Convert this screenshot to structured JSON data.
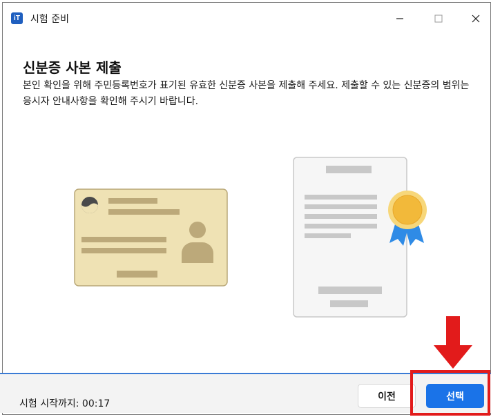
{
  "window": {
    "title": "시험 준비",
    "icon": "app-logo-icon",
    "icon_text": "iT",
    "controls": [
      "minimize-icon",
      "maximize-icon",
      "close-icon"
    ]
  },
  "main": {
    "heading": "신분증 사본 제출",
    "description": "본인 확인을 위해 주민등록번호가 표기된 유효한 신분증 사본을 제출해 주세요. 제출할 수 있는 신분증의 범위는 응시자 안내사항을 확인해 주시기 바랍니다."
  },
  "illustrations": {
    "id_card": "id-card-illustration",
    "certificate": "certificate-illustration",
    "colors": {
      "card_fill": "#efe2b4",
      "card_border": "#b9a878",
      "card_bars": "#bca97a",
      "cert_bars": "#c8c8c8",
      "medal": "#f6c244",
      "ribbon": "#2f8be6"
    }
  },
  "footer": {
    "timer_label": "시험 시작까지:",
    "timer_value": "00:17",
    "prev_label": "이전",
    "select_label": "선택"
  },
  "colors": {
    "accent": "#1a73e8",
    "annotation_red": "#e21b1b",
    "footer_bg": "#f3f3f3"
  }
}
